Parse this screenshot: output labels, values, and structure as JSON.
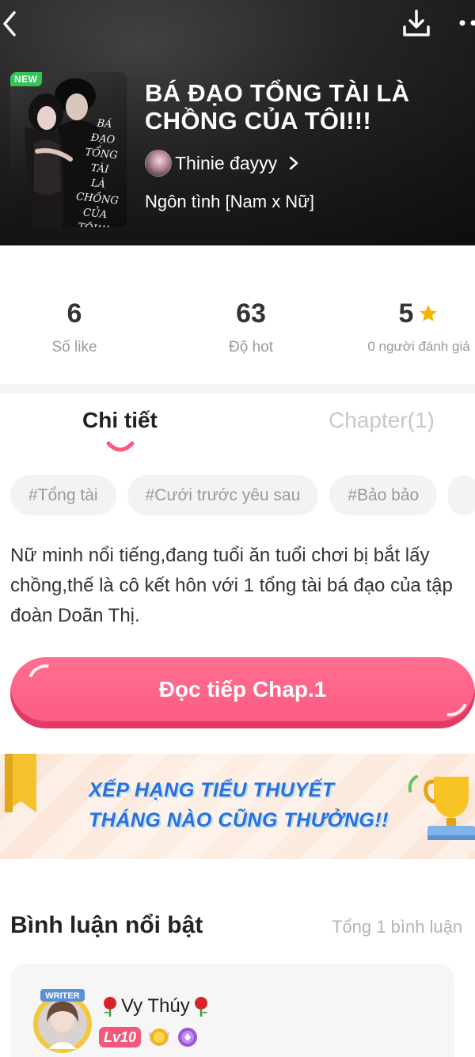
{
  "header": {
    "cover_badge": "NEW",
    "cover_text_lines": [
      "BÁ",
      "ĐẠO",
      "TỔNG",
      "TÀI",
      "LÀ",
      "CHỒNG",
      "CỦA",
      "TÔI!!!"
    ],
    "title": "BÁ ĐẠO TỔNG TÀI LÀ CHỒNG CỦA TÔI!!!",
    "author": "Thinie đayyy",
    "genre": "Ngôn tình [Nam x Nữ]"
  },
  "stats": {
    "likes": {
      "value": "6",
      "label": "Số like"
    },
    "hot": {
      "value": "63",
      "label": "Độ hot"
    },
    "rating": {
      "value": "5",
      "label": "0 người đánh giá"
    }
  },
  "tabs": {
    "details": "Chi tiết",
    "chapters": "Chapter(1)"
  },
  "tags": [
    "#Tổng tài",
    "#Cưới trước yêu sau",
    "#Bảo bảo"
  ],
  "synopsis": "Nữ minh nổi tiếng,đang tuổi ăn tuổi chơi bị bắt lấy chồng,thế là cô kết hôn với 1 tổng tài bá đạo của tập đoàn Doãn Thị.",
  "read_button": "Đọc tiếp Chap.1",
  "banner": {
    "line1": "XẾP HẠNG TIỂU THUYẾT",
    "line2": "THÁNG NÀO CŨNG THƯỞNG!!"
  },
  "comments": {
    "title": "Bình luận nổi bật",
    "count": "Tổng 1 bình luận",
    "items": [
      {
        "avatar_badge": "WRITER",
        "name": "Vy Thúy",
        "level": "Lv10"
      }
    ]
  },
  "colors": {
    "accent": "#fb5a80",
    "tag_bg": "#f3f3f3",
    "banner_text": "#2a6fdb",
    "new_badge": "#33c45a",
    "star": "#f5b400"
  },
  "icons": [
    "back-icon",
    "download-icon",
    "more-icon",
    "chevron-right-icon",
    "star-icon",
    "ribbon-icon",
    "trophy-icon",
    "rose-icon",
    "medal-icon",
    "gem-icon"
  ]
}
